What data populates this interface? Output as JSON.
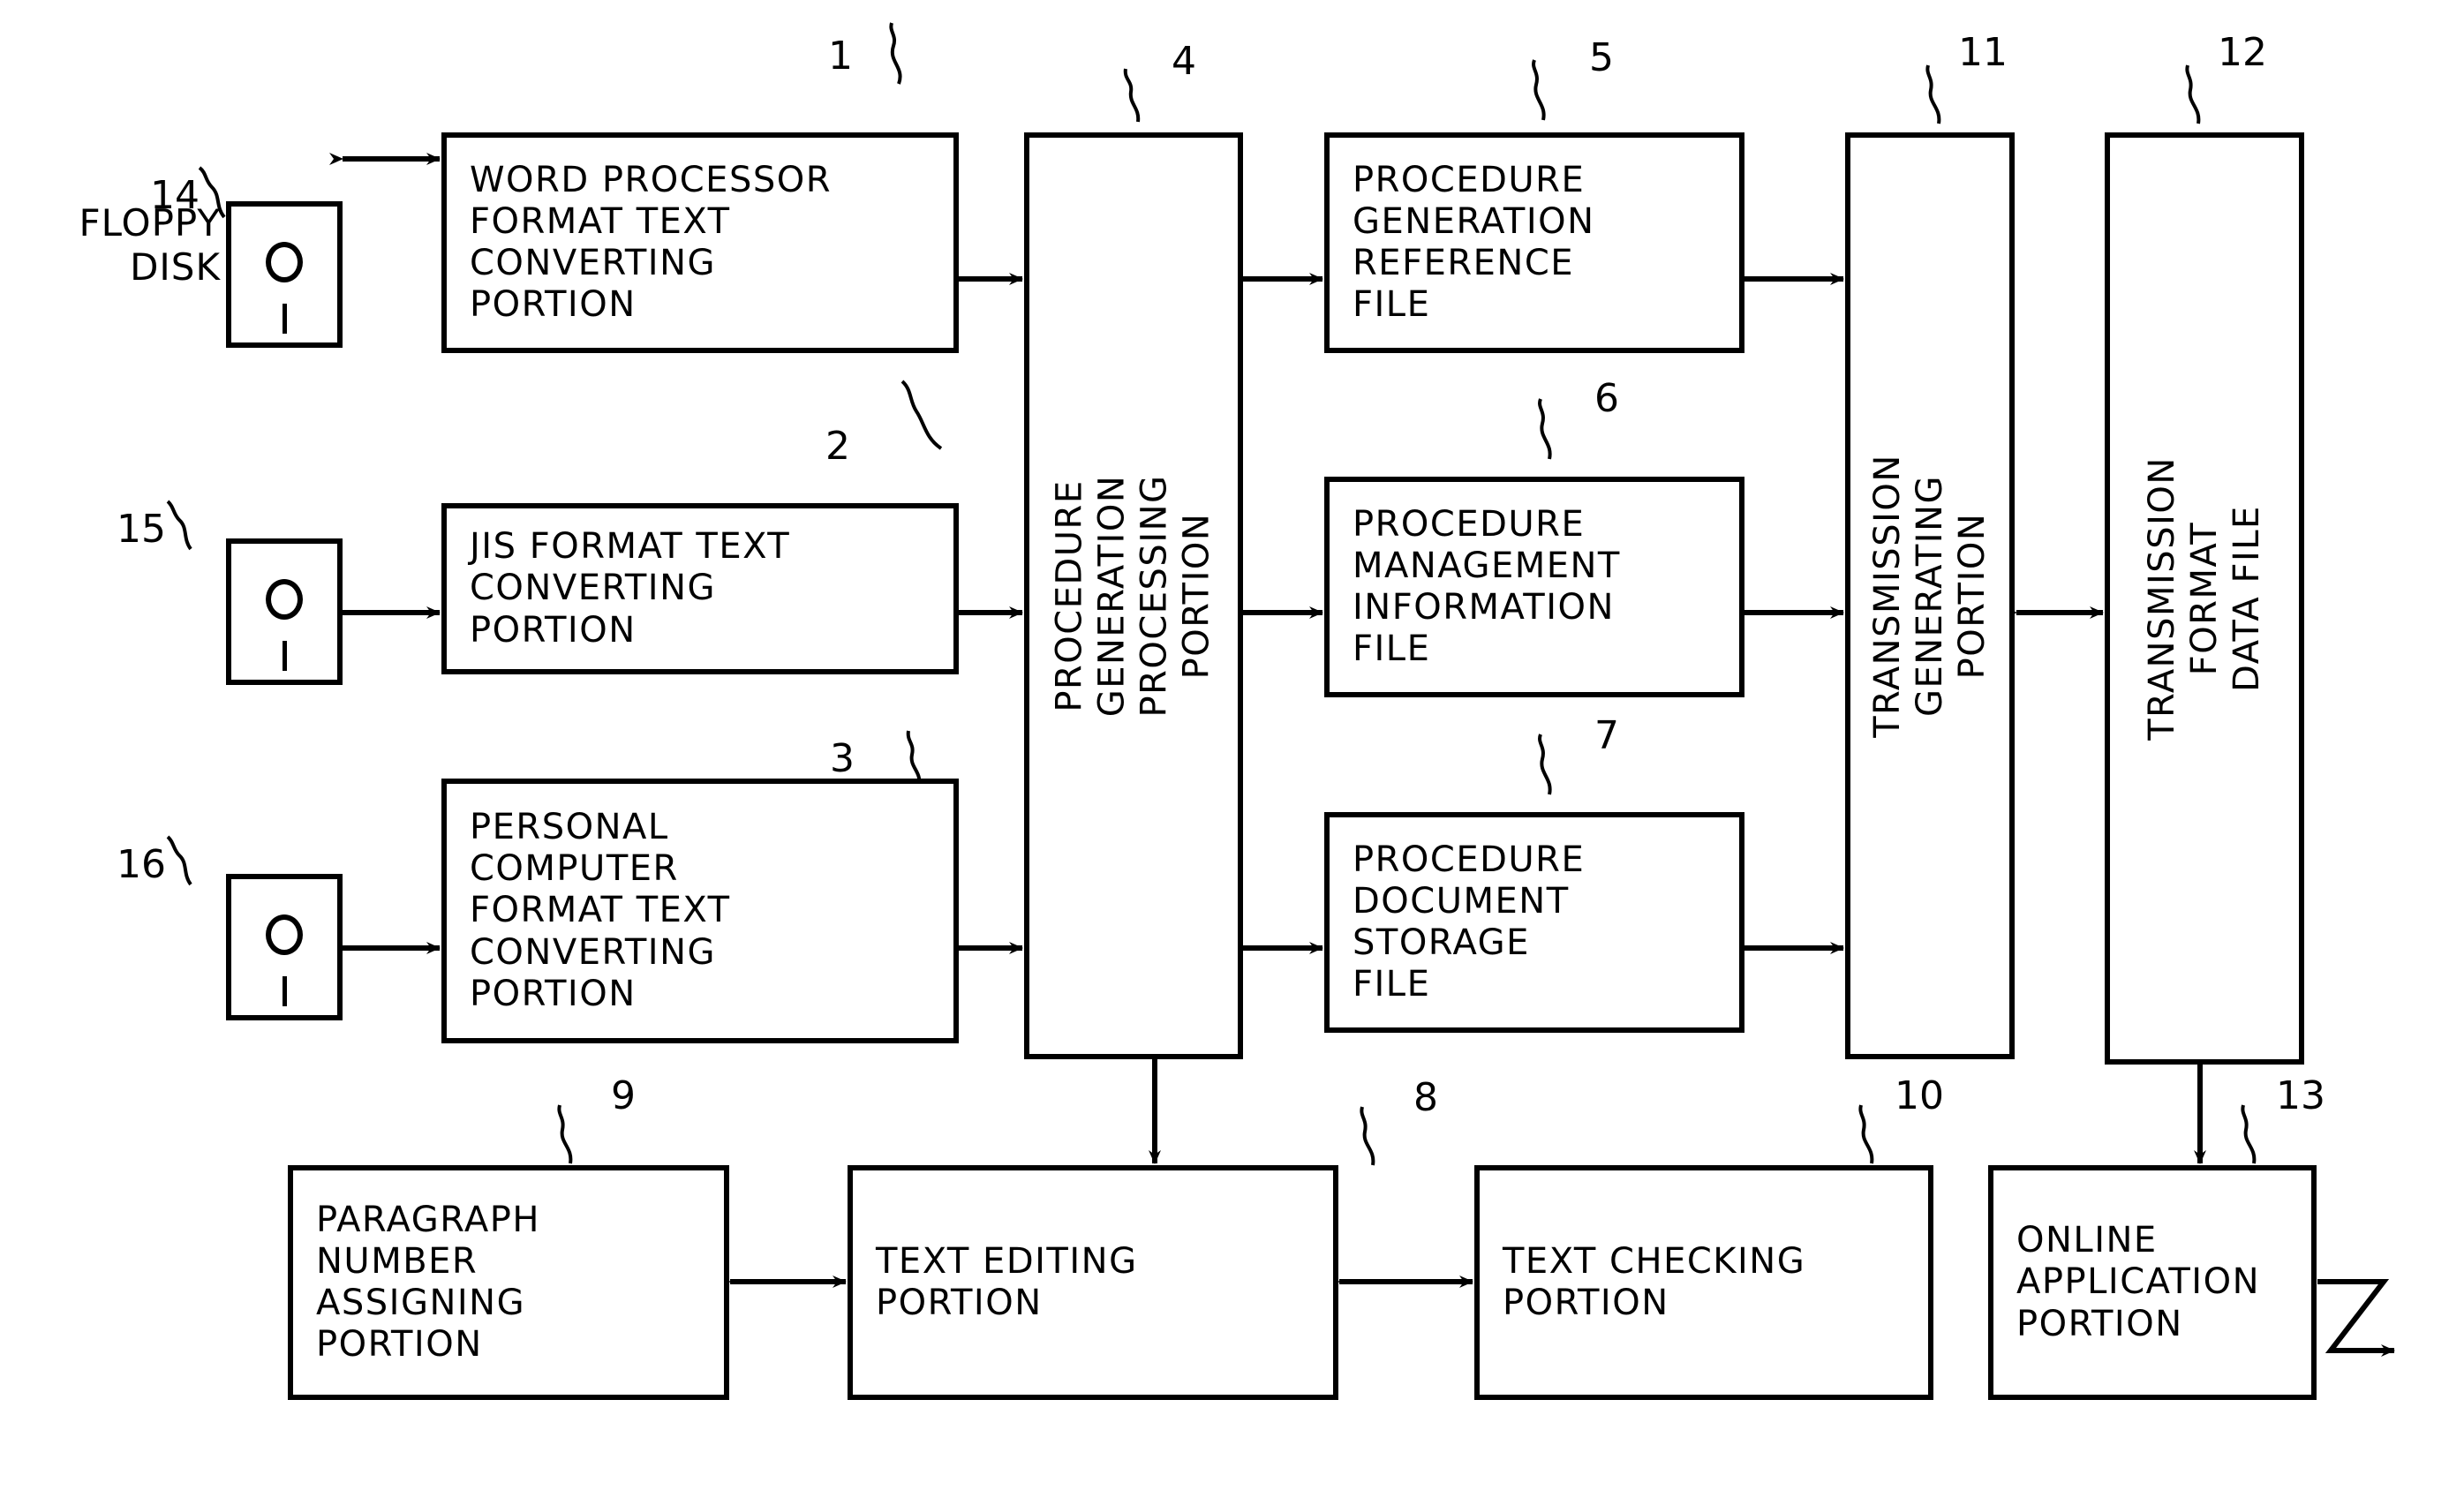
{
  "figure": {
    "type": "patent-block-diagram",
    "line_color": "#000000",
    "background_color": "#ffffff"
  },
  "labels": {
    "floppy_disk": "FLOPPY\nDISK"
  },
  "blocks": [
    {
      "id": "block-1",
      "ref": "1",
      "name": "word-processor-format-text-converting-portion",
      "text": "WORD PROCESSOR\nFORMAT TEXT\nCONVERTING\nPORTION",
      "orientation": "horizontal"
    },
    {
      "id": "block-2",
      "ref": "2",
      "name": "jis-format-text-converting-portion",
      "text": "JIS FORMAT TEXT\nCONVERTING\nPORTION",
      "orientation": "horizontal"
    },
    {
      "id": "block-3",
      "ref": "3",
      "name": "personal-computer-format-text-converting-portion",
      "text": "PERSONAL\nCOMPUTER\nFORMAT TEXT\nCONVERTING\nPORTION",
      "orientation": "horizontal"
    },
    {
      "id": "block-4",
      "ref": "4",
      "name": "procedure-generation-processing-portion",
      "text": "PROCEDURE  GENERATION\nPROCESSING  PORTION",
      "orientation": "vertical"
    },
    {
      "id": "block-5",
      "ref": "5",
      "name": "procedure-generation-reference-file",
      "text": "PROCEDURE\nGENERATION\nREFERENCE\nFILE",
      "orientation": "horizontal"
    },
    {
      "id": "block-6",
      "ref": "6",
      "name": "procedure-management-information-file",
      "text": "PROCEDURE\nMANAGEMENT\nINFORMATION\nFILE",
      "orientation": "horizontal"
    },
    {
      "id": "block-7",
      "ref": "7",
      "name": "procedure-document-storage-file",
      "text": "PROCEDURE\nDOCUMENT\nSTORAGE\nFILE",
      "orientation": "horizontal"
    },
    {
      "id": "block-8",
      "ref": "8",
      "name": "text-editing-portion",
      "text": "TEXT EDITING\nPORTION",
      "orientation": "horizontal"
    },
    {
      "id": "block-9",
      "ref": "9",
      "name": "paragraph-number-assigning-portion",
      "text": "PARAGRAPH\nNUMBER\nASSIGNING\nPORTION",
      "orientation": "horizontal"
    },
    {
      "id": "block-10",
      "ref": "10",
      "name": "text-checking-portion",
      "text": "TEXT CHECKING\nPORTION",
      "orientation": "horizontal"
    },
    {
      "id": "block-11",
      "ref": "11",
      "name": "transmission-generating-portion",
      "text": "TRANSMISSION\nGENERATING PORTION",
      "orientation": "vertical"
    },
    {
      "id": "block-12",
      "ref": "12",
      "name": "transmission-format-data-file",
      "text": "TRANSMISSION FORMAT\nDATA FILE",
      "orientation": "vertical"
    },
    {
      "id": "block-13",
      "ref": "13",
      "name": "online-application-portion",
      "text": "ONLINE\nAPPLICATION\nPORTION",
      "orientation": "horizontal"
    }
  ],
  "devices": [
    {
      "id": "device-14",
      "ref": "14",
      "name": "floppy-disk-drive-14",
      "label": "FLOPPY\nDISK"
    },
    {
      "id": "device-15",
      "ref": "15",
      "name": "floppy-disk-drive-15",
      "label": ""
    },
    {
      "id": "device-16",
      "ref": "16",
      "name": "floppy-disk-drive-16",
      "label": ""
    }
  ],
  "refs": {
    "r1": "1",
    "r2": "2",
    "r3": "3",
    "r4": "4",
    "r5": "5",
    "r6": "6",
    "r7": "7",
    "r8": "8",
    "r9": "9",
    "r10": "10",
    "r11": "11",
    "r12": "12",
    "r13": "13",
    "r14": "14",
    "r15": "15",
    "r16": "16"
  }
}
